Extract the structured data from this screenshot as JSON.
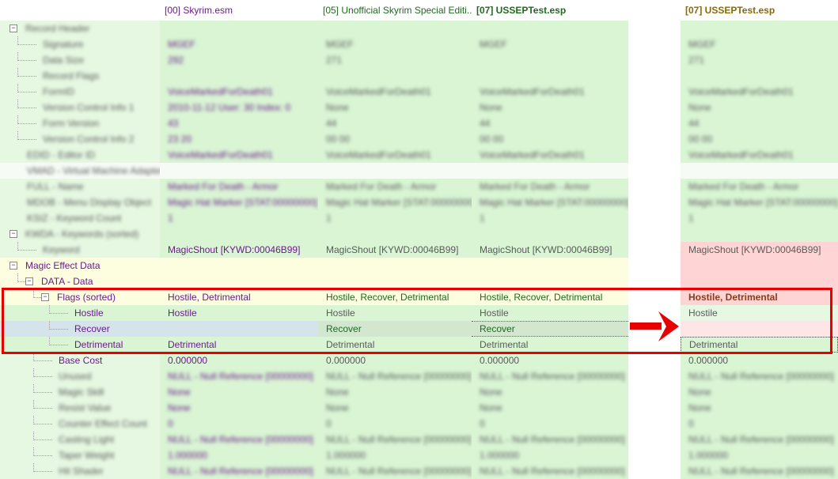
{
  "header": {
    "col0": "[00] Skyrim.esm",
    "col1": "[05] Unofficial Skyrim Special Editi...",
    "col2": "[07] USSEPTest.esp",
    "col3": "[07] USSEPTest.esp"
  },
  "rows": {
    "record_header": "Record Header",
    "signature": "Signature",
    "data_size": "Data Size",
    "record_flags": "Record Flags",
    "formid": "FormID",
    "vci1": "Version Control Info 1",
    "form_version": "Form Version",
    "vci2": "Version Control Info 2",
    "edid": "EDID - Editor ID",
    "vmad": "VMAD - Virtual Machine Adapter",
    "full": "FULL - Name",
    "mdob": "MDOB - Menu Display Object",
    "ksiz": "KSIZ - Keyword Count",
    "kwda": "KWDA - Keywords (sorted)",
    "keyword": "Keyword",
    "magic_effect_data": "Magic Effect Data",
    "data_data": "DATA - Data",
    "flags_sorted": "Flags (sorted)",
    "hostile": "Hostile",
    "recover": "Recover",
    "detrimental": "Detrimental",
    "base_cost": "Base Cost",
    "unused": "Unused",
    "magic_skill": "Magic Skill",
    "resist_value": "Resist Value",
    "counter_effect_count": "Counter Effect Count",
    "casting_light": "Casting Light",
    "taper_weight": "Taper Weight",
    "hit_shader": "Hit Shader"
  },
  "values": {
    "signature": [
      "MGEF",
      "MGEF",
      "MGEF",
      "MGEF"
    ],
    "data_size": [
      "292",
      "271",
      "",
      "271"
    ],
    "formid": [
      "VoiceMarkedForDeath01",
      "VoiceMarkedForDeath01",
      "VoiceMarkedForDeath01",
      "VoiceMarkedForDeath01"
    ],
    "vci1": [
      "2010-11-12 User: 30 Index: 0",
      "None",
      "None",
      "None"
    ],
    "form_version": [
      "43",
      "44",
      "44",
      "44"
    ],
    "vci2": [
      "23 20",
      "00 00",
      "00 00",
      "00 00"
    ],
    "edid": [
      "VoiceMarkedForDeath01",
      "VoiceMarkedForDeath01",
      "VoiceMarkedForDeath01",
      "VoiceMarkedForDeath01"
    ],
    "full": [
      "Marked For Death - Armor",
      "Marked For Death - Armor",
      "Marked For Death - Armor",
      "Marked For Death - Armor"
    ],
    "mdob": [
      "Magic Hat Marker [STAT:00000000]",
      "Magic Hat Marker [STAT:00000000]",
      "Magic Hat Marker [STAT:00000000]",
      "Magic Hat Marker [STAT:00000000]"
    ],
    "ksiz": [
      "1",
      "1",
      "1",
      "1"
    ],
    "keyword": [
      "MagicShout [KYWD:00046B99]",
      "MagicShout [KYWD:00046B99]",
      "MagicShout [KYWD:00046B99]",
      "MagicShout [KYWD:00046B99]"
    ],
    "flags_sorted": [
      "Hostile, Detrimental",
      "Hostile, Recover, Detrimental",
      "Hostile, Recover, Detrimental",
      "Hostile, Detrimental"
    ],
    "hostile": [
      "Hostile",
      "Hostile",
      "Hostile",
      "Hostile"
    ],
    "recover": [
      "",
      "Recover",
      "Recover",
      ""
    ],
    "detrimental": [
      "Detrimental",
      "Detrimental",
      "Detrimental",
      "Detrimental"
    ],
    "base_cost": [
      "0.000000",
      "0.000000",
      "0.000000",
      "0.000000"
    ],
    "unused": [
      "NULL - Null Reference [00000000]",
      "NULL - Null Reference [00000000]",
      "NULL - Null Reference [00000000]",
      "NULL - Null Reference [00000000]"
    ],
    "magic_skill": [
      "None",
      "None",
      "None",
      "None"
    ],
    "resist_value": [
      "None",
      "None",
      "None",
      "None"
    ],
    "counter_effect_count": [
      "0",
      "0",
      "0",
      "0"
    ],
    "casting_light": [
      "NULL - Null Reference [00000000]",
      "NULL - Null Reference [00000000]",
      "NULL - Null Reference [00000000]",
      "NULL - Null Reference [00000000]"
    ],
    "taper_weight": [
      "1.000000",
      "1.000000",
      "1.000000",
      "1.000000"
    ],
    "hit_shader": [
      "NULL - Null Reference [00000000]",
      "NULL - Null Reference [00000000]",
      "NULL - Null Reference [00000000]",
      "NULL - Null Reference [00000000]"
    ]
  },
  "colors": {
    "green_bg": "#d9f5d4",
    "green_bg_alt": "#e6f8e2",
    "yellow_bg": "#fdfde0",
    "pink_bg": "#ffd4d4",
    "pink_bg_light": "#ffe6e6",
    "blue_selected": "#d4e4ea",
    "highlight_frame": "#e60000"
  }
}
